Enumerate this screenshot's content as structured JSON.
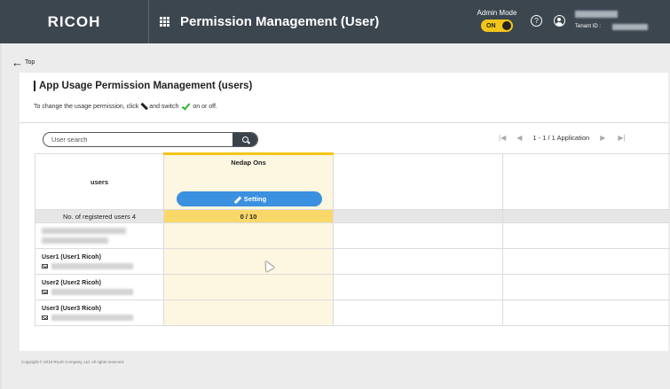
{
  "header": {
    "logo": "RICOH",
    "title": "Permission Management (User)",
    "admin_mode_label": "Admin Mode",
    "admin_toggle": "ON",
    "help_glyph": "?",
    "tenant_label": "Tenant ID :"
  },
  "nav": {
    "back_label": "Top"
  },
  "page": {
    "title": "App Usage Permission Management (users)",
    "instruction_pre": "To change the usage permission, click",
    "instruction_mid": "and switch",
    "instruction_post": "on or off."
  },
  "search": {
    "placeholder": "User search"
  },
  "pager": {
    "text": "1 - 1 / 1 Application"
  },
  "table": {
    "users_header": "users",
    "app_name": "Nedap Ons",
    "setting_label": "Setting",
    "count_label": "No. of registered users 4",
    "count_value": "0 / 10",
    "users": [
      {
        "name": "User1 (User1 Ricoh)"
      },
      {
        "name": "User2 (User2 Ricoh)"
      },
      {
        "name": "User3 (User3 Ricoh)"
      }
    ]
  },
  "footer": {
    "copyright": "Copyright © 2019 Ricoh Company, Ltd. All rights reserved."
  },
  "colors": {
    "header_bg": "#3c464f",
    "accent_yellow": "#f3c51a",
    "setting_blue": "#3b91e0",
    "check_green": "#2fb52f"
  },
  "icons": [
    "grid-icon",
    "help-icon",
    "user-icon",
    "back-arrow-icon",
    "pencil-icon",
    "check-icon",
    "search-icon",
    "mail-icon",
    "first-page-icon",
    "prev-page-icon",
    "next-page-icon",
    "last-page-icon"
  ]
}
